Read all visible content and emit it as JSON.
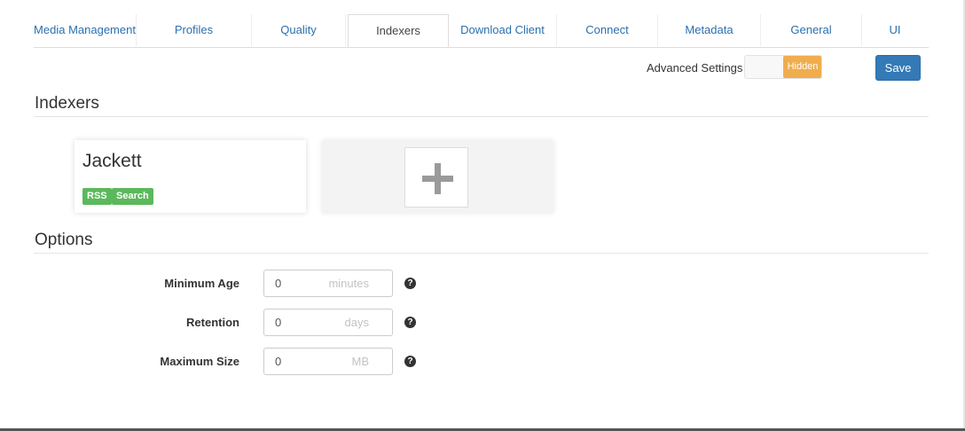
{
  "tabs": [
    {
      "label": "Media Management"
    },
    {
      "label": "Profiles"
    },
    {
      "label": "Quality"
    },
    {
      "label": "Indexers"
    },
    {
      "label": "Download Client"
    },
    {
      "label": "Connect"
    },
    {
      "label": "Metadata"
    },
    {
      "label": "General"
    },
    {
      "label": "UI"
    }
  ],
  "active_tab": "Indexers",
  "toolbar": {
    "advanced_label": "Advanced Settings",
    "advanced_toggle_state": "Hidden",
    "save_label": "Save"
  },
  "indexers": {
    "title": "Indexers",
    "items": [
      {
        "name": "Jackett",
        "badges": [
          "RSS",
          "Search"
        ]
      }
    ],
    "add_icon": "plus-icon"
  },
  "options": {
    "title": "Options",
    "fields": [
      {
        "label": "Minimum Age",
        "value": "0",
        "unit": "minutes"
      },
      {
        "label": "Retention",
        "value": "0",
        "unit": "days"
      },
      {
        "label": "Maximum Size",
        "value": "0",
        "unit": "MB"
      }
    ],
    "help_icon": "question-circle-icon"
  },
  "colors": {
    "link": "#2a6fb0",
    "primary": "#337ab7",
    "warning": "#f0ad4e",
    "success": "#5cb85c"
  }
}
